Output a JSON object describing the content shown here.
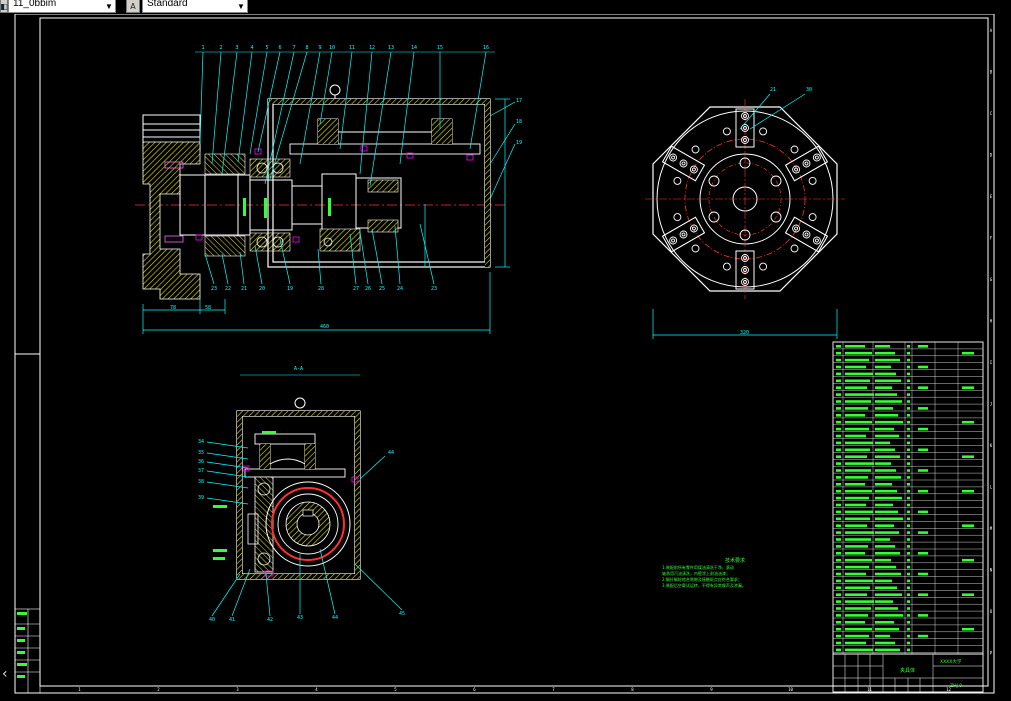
{
  "toolbar": {
    "layer_combo": {
      "value": "11_0bbim"
    },
    "style_combo": {
      "value": "Standard"
    }
  },
  "drawing": {
    "section_label": "A-A",
    "section_marker": "A",
    "tech_title": "技术要求",
    "tech_lines": [
      "1.装配前所有零件用煤油清洗干净，滚动",
      "轴承用汽油清洗，内壁涂上耐油油漆；",
      "2.蜗杆蜗轮啮合侧隙及接触斑点应符合要求；",
      "3.装配后空载试运转，不得有异常噪声及渗漏。"
    ],
    "balloons_top": [
      "1",
      "2",
      "3",
      "4",
      "5",
      "6",
      "7",
      "8",
      "9",
      "10",
      "11",
      "12",
      "13",
      "14",
      "15",
      "16"
    ],
    "balloons_bottom": [
      "23",
      "22",
      "21",
      "20",
      "19",
      "28",
      "27",
      "26",
      "25",
      "24",
      "23"
    ],
    "balloons_right": [
      "17",
      "18",
      "19"
    ],
    "balloons_section_left": [
      "34",
      "35",
      "36",
      "37",
      "38",
      "39"
    ],
    "balloons_section_bottom": [
      "40",
      "41",
      "42",
      "43",
      "44",
      "45"
    ],
    "balloons_section_right": [
      "44"
    ],
    "balloons_disc": [
      "21",
      "30"
    ],
    "dim_left": "78",
    "dim_mid": "58",
    "dim_total": "460",
    "dim_disc": "320",
    "border_cols": [
      "1",
      "2",
      "3",
      "4",
      "5",
      "6",
      "7",
      "8",
      "9",
      "10",
      "11",
      "12"
    ],
    "border_rows": [
      "A",
      "B",
      "C",
      "D",
      "E",
      "F",
      "G",
      "H",
      "I",
      "J",
      "K",
      "L",
      "M",
      "N",
      "O",
      "P"
    ],
    "title_block": {
      "title": "夹具体",
      "drawing_no": "ZHJ-0",
      "company": "XXXX大学"
    }
  },
  "colors": {
    "background": "#000000",
    "geometry": "#ffffff",
    "annotation": "#00ffff",
    "hatch": "#ffff00",
    "centerline": "#ff3030",
    "text_green": "#33ff33",
    "magenta": "#ff00ff"
  },
  "icons": {
    "style_icon": "text-style-icon",
    "left_arrow": "chevron-left-icon"
  }
}
